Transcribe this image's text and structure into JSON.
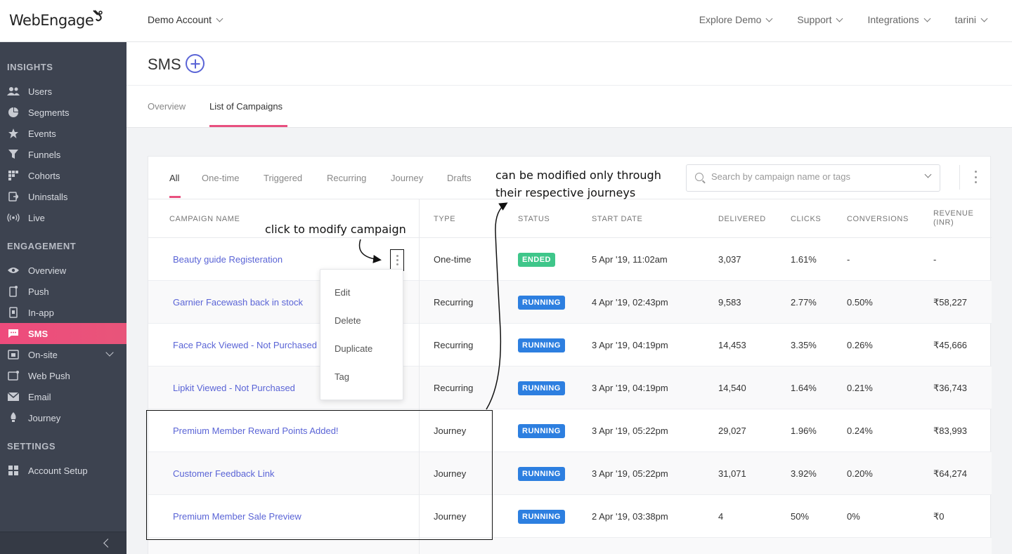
{
  "topbar": {
    "logo": "WebEngage",
    "account": "Demo Account",
    "nav": [
      "Explore Demo",
      "Support",
      "Integrations",
      "tarini"
    ]
  },
  "sidebar": {
    "sections": [
      "INSIGHTS",
      "ENGAGEMENT",
      "SETTINGS"
    ],
    "insights": [
      {
        "label": "Users",
        "icon": "users-icon"
      },
      {
        "label": "Segments",
        "icon": "pie-icon"
      },
      {
        "label": "Events",
        "icon": "star-icon"
      },
      {
        "label": "Funnels",
        "icon": "funnel-icon"
      },
      {
        "label": "Cohorts",
        "icon": "cohort-icon"
      },
      {
        "label": "Uninstalls",
        "icon": "uninstall-icon"
      },
      {
        "label": "Live",
        "icon": "live-icon"
      }
    ],
    "engagement": [
      {
        "label": "Overview",
        "icon": "eye-icon"
      },
      {
        "label": "Push",
        "icon": "push-icon"
      },
      {
        "label": "In-app",
        "icon": "inapp-icon"
      },
      {
        "label": "SMS",
        "icon": "sms-icon"
      },
      {
        "label": "On-site",
        "icon": "onsite-icon"
      },
      {
        "label": "Web Push",
        "icon": "webpush-icon"
      },
      {
        "label": "Email",
        "icon": "email-icon"
      },
      {
        "label": "Journey",
        "icon": "journey-icon"
      }
    ],
    "settings": [
      {
        "label": "Account Setup",
        "icon": "setup-icon"
      }
    ],
    "active": "SMS",
    "accent": "#e8507f"
  },
  "page": {
    "title": "SMS",
    "tabs": [
      "Overview",
      "List of Campaigns"
    ],
    "active_tab": "List of Campaigns"
  },
  "filters": {
    "tabs": [
      "All",
      "One-time",
      "Triggered",
      "Recurring",
      "Journey",
      "Drafts"
    ],
    "active": "All",
    "search_placeholder": "Search by campaign name or tags"
  },
  "table": {
    "headers": {
      "name": "CAMPAIGN NAME",
      "type": "TYPE",
      "status": "STATUS",
      "start": "START DATE",
      "delivered": "DELIVERED",
      "clicks": "CLICKS",
      "conversions": "CONVERSIONS",
      "revenue": "REVENUE (INR)"
    },
    "rows": [
      {
        "name": "Beauty guide Registeration",
        "type": "One-time",
        "status": "ENDED",
        "start": "5 Apr '19, 11:02am",
        "delivered": "3,037",
        "clicks": "1.61%",
        "conversions": "-",
        "revenue": "-"
      },
      {
        "name": "Garnier Facewash back in stock",
        "type": "Recurring",
        "status": "RUNNING",
        "start": "4 Apr '19, 02:43pm",
        "delivered": "9,583",
        "clicks": "2.77%",
        "conversions": "0.50%",
        "revenue": "₹58,227"
      },
      {
        "name": "Face Pack Viewed - Not Purchased",
        "type": "Recurring",
        "status": "RUNNING",
        "start": "3 Apr '19, 04:19pm",
        "delivered": "14,453",
        "clicks": "3.35%",
        "conversions": "0.26%",
        "revenue": "₹45,666"
      },
      {
        "name": "Lipkit Viewed - Not Purchased",
        "type": "Recurring",
        "status": "RUNNING",
        "start": "3 Apr '19, 04:19pm",
        "delivered": "14,540",
        "clicks": "1.64%",
        "conversions": "0.21%",
        "revenue": "₹36,743"
      },
      {
        "name": "Premium Member Reward Points Added!",
        "type": "Journey",
        "status": "RUNNING",
        "start": "3 Apr '19, 05:22pm",
        "delivered": "29,027",
        "clicks": "1.96%",
        "conversions": "0.24%",
        "revenue": "₹83,993"
      },
      {
        "name": "Customer Feedback Link",
        "type": "Journey",
        "status": "RUNNING",
        "start": "3 Apr '19, 05:22pm",
        "delivered": "31,071",
        "clicks": "3.92%",
        "conversions": "0.20%",
        "revenue": "₹64,274"
      },
      {
        "name": "Premium Member Sale Preview",
        "type": "Journey",
        "status": "RUNNING",
        "start": "2 Apr '19, 03:38pm",
        "delivered": "4",
        "clicks": "50%",
        "conversions": "0%",
        "revenue": "₹0"
      }
    ]
  },
  "row_menu": [
    "Edit",
    "Delete",
    "Duplicate",
    "Tag"
  ],
  "annotations": {
    "modify": "click to modify campaign",
    "journeys_line1": "can be modified only through",
    "journeys_line2": "their respective journeys"
  },
  "colors": {
    "link": "#5a64d6",
    "ended": "#3fc68a",
    "running": "#2d7fe0",
    "sidebar_bg": "#3d4350"
  }
}
